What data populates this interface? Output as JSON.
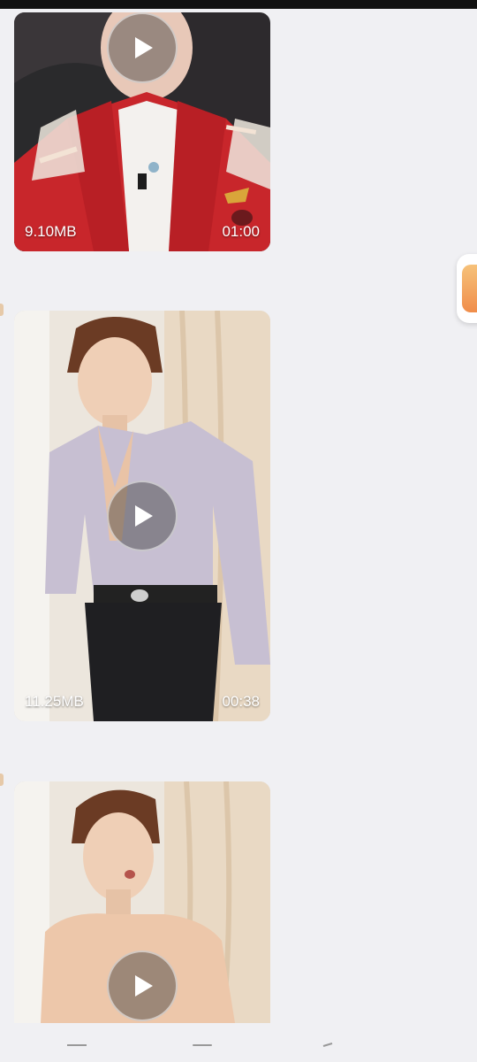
{
  "videos": [
    {
      "size": "9.10MB",
      "duration": "01:00"
    },
    {
      "size": "11.25MB",
      "duration": "00:38"
    },
    {
      "size": "",
      "duration": ""
    }
  ],
  "icons": {
    "play": "play-icon",
    "floating": "app-shortcut-icon",
    "nav": [
      "menu-icon",
      "home-icon",
      "back-icon"
    ]
  },
  "colors": {
    "background": "#f0f0f3",
    "jacket_red": "#c8262b",
    "shirt_lavender": "#c7bfd2",
    "skin": "#e9c3a6",
    "hair": "#6b3b24",
    "curtain": "#e9d9c4"
  }
}
